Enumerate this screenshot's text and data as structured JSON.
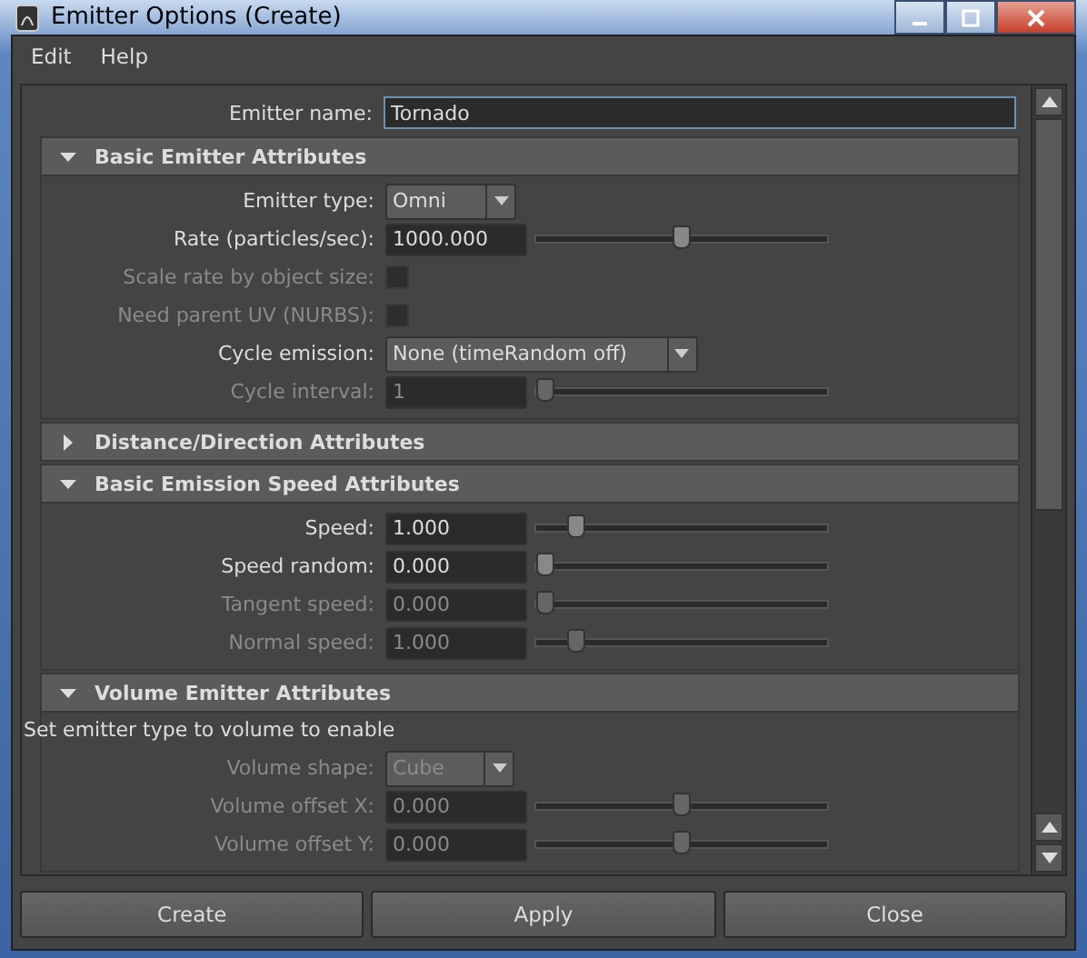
{
  "window": {
    "title": "Emitter Options (Create)"
  },
  "menu": [
    "Edit",
    "Help"
  ],
  "emitter_name": {
    "label": "Emitter name:",
    "value": "Tornado"
  },
  "sections": [
    {
      "title": "Basic Emitter Attributes",
      "expanded": true,
      "rows": [
        {
          "kind": "dropdown",
          "label": "Emitter type:",
          "value": "Omni",
          "disabled": false
        },
        {
          "kind": "slider",
          "label": "Rate (particles/sec):",
          "value": "1000.000",
          "level": 0.5,
          "disabled": false
        },
        {
          "kind": "checkbox",
          "label": "Scale rate by object size:",
          "checked": false,
          "disabled": true
        },
        {
          "kind": "checkbox",
          "label": "Need parent UV (NURBS):",
          "checked": false,
          "disabled": true
        },
        {
          "kind": "dropdown",
          "label": "Cycle emission:",
          "value": "None (timeRandom off)",
          "disabled": false
        },
        {
          "kind": "slider",
          "label": "Cycle interval:",
          "value": "1",
          "level": 0.0,
          "disabled": true
        }
      ]
    },
    {
      "title": "Distance/Direction Attributes",
      "expanded": false
    },
    {
      "title": "Basic Emission Speed Attributes",
      "expanded": true,
      "rows": [
        {
          "kind": "slider",
          "label": "Speed:",
          "value": "1.000",
          "level": 0.11,
          "disabled": false
        },
        {
          "kind": "slider",
          "label": "Speed random:",
          "value": "0.000",
          "level": 0.0,
          "disabled": false
        },
        {
          "kind": "slider",
          "label": "Tangent speed:",
          "value": "0.000",
          "level": 0.0,
          "disabled": true
        },
        {
          "kind": "slider",
          "label": "Normal speed:",
          "value": "1.000",
          "level": 0.11,
          "disabled": true
        }
      ]
    },
    {
      "title": "Volume Emitter Attributes",
      "expanded": true,
      "note": "Set emitter type to volume to enable",
      "rows": [
        {
          "kind": "dropdown",
          "label": "Volume shape:",
          "value": "Cube",
          "disabled": true
        },
        {
          "kind": "slider",
          "label": "Volume offset X:",
          "value": "0.000",
          "level": 0.5,
          "disabled": true
        },
        {
          "kind": "slider",
          "label": "Volume offset Y:",
          "value": "0.000",
          "level": 0.5,
          "disabled": true
        }
      ]
    }
  ],
  "buttons": [
    "Create",
    "Apply",
    "Close"
  ]
}
